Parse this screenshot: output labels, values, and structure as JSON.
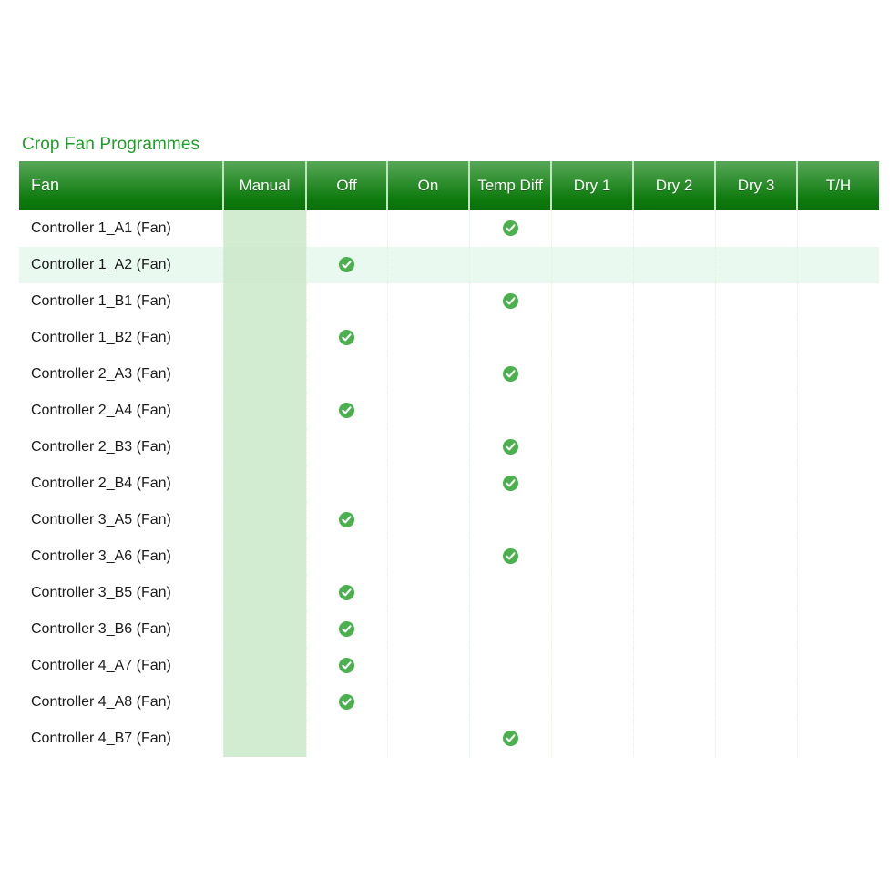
{
  "panel": {
    "title": "Crop Fan Programmes",
    "title_color": "#1e9e28",
    "header_gradient_top": "#57a757",
    "header_gradient_bottom": "#0a700a",
    "check_icon_color": "#4cb050",
    "manual_band_color": "#d2ecd2",
    "alt_row_color": "#e9f9ef"
  },
  "table": {
    "columns": [
      {
        "key": "fan",
        "label": "Fan"
      },
      {
        "key": "manual",
        "label": "Manual"
      },
      {
        "key": "off",
        "label": "Off"
      },
      {
        "key": "on",
        "label": "On"
      },
      {
        "key": "tempdiff",
        "label": "Temp Diff"
      },
      {
        "key": "dry1",
        "label": "Dry 1"
      },
      {
        "key": "dry2",
        "label": "Dry 2"
      },
      {
        "key": "dry3",
        "label": "Dry 3"
      },
      {
        "key": "th",
        "label": "T/H"
      }
    ],
    "check_glyph_name": "check-circle-icon",
    "rows": [
      {
        "fan": "Controller 1_A1 (Fan)",
        "manual": false,
        "off": false,
        "on": false,
        "tempdiff": true,
        "dry1": false,
        "dry2": false,
        "dry3": false,
        "th": false
      },
      {
        "fan": "Controller 1_A2 (Fan)",
        "manual": false,
        "off": true,
        "on": false,
        "tempdiff": false,
        "dry1": false,
        "dry2": false,
        "dry3": false,
        "th": false
      },
      {
        "fan": "Controller 1_B1 (Fan)",
        "manual": false,
        "off": false,
        "on": false,
        "tempdiff": true,
        "dry1": false,
        "dry2": false,
        "dry3": false,
        "th": false
      },
      {
        "fan": "Controller 1_B2 (Fan)",
        "manual": false,
        "off": true,
        "on": false,
        "tempdiff": false,
        "dry1": false,
        "dry2": false,
        "dry3": false,
        "th": false
      },
      {
        "fan": "Controller 2_A3 (Fan)",
        "manual": false,
        "off": false,
        "on": false,
        "tempdiff": true,
        "dry1": false,
        "dry2": false,
        "dry3": false,
        "th": false
      },
      {
        "fan": "Controller 2_A4 (Fan)",
        "manual": false,
        "off": true,
        "on": false,
        "tempdiff": false,
        "dry1": false,
        "dry2": false,
        "dry3": false,
        "th": false
      },
      {
        "fan": "Controller 2_B3 (Fan)",
        "manual": false,
        "off": false,
        "on": false,
        "tempdiff": true,
        "dry1": false,
        "dry2": false,
        "dry3": false,
        "th": false
      },
      {
        "fan": "Controller 2_B4 (Fan)",
        "manual": false,
        "off": false,
        "on": false,
        "tempdiff": true,
        "dry1": false,
        "dry2": false,
        "dry3": false,
        "th": false
      },
      {
        "fan": "Controller 3_A5 (Fan)",
        "manual": false,
        "off": true,
        "on": false,
        "tempdiff": false,
        "dry1": false,
        "dry2": false,
        "dry3": false,
        "th": false
      },
      {
        "fan": "Controller 3_A6 (Fan)",
        "manual": false,
        "off": false,
        "on": false,
        "tempdiff": true,
        "dry1": false,
        "dry2": false,
        "dry3": false,
        "th": false
      },
      {
        "fan": "Controller 3_B5 (Fan)",
        "manual": false,
        "off": true,
        "on": false,
        "tempdiff": false,
        "dry1": false,
        "dry2": false,
        "dry3": false,
        "th": false
      },
      {
        "fan": "Controller 3_B6 (Fan)",
        "manual": false,
        "off": true,
        "on": false,
        "tempdiff": false,
        "dry1": false,
        "dry2": false,
        "dry3": false,
        "th": false
      },
      {
        "fan": "Controller 4_A7 (Fan)",
        "manual": false,
        "off": true,
        "on": false,
        "tempdiff": false,
        "dry1": false,
        "dry2": false,
        "dry3": false,
        "th": false
      },
      {
        "fan": "Controller 4_A8 (Fan)",
        "manual": false,
        "off": true,
        "on": false,
        "tempdiff": false,
        "dry1": false,
        "dry2": false,
        "dry3": false,
        "th": false
      },
      {
        "fan": "Controller 4_B7 (Fan)",
        "manual": false,
        "off": false,
        "on": false,
        "tempdiff": true,
        "dry1": false,
        "dry2": false,
        "dry3": false,
        "th": false
      }
    ],
    "highlighted_row_index": 1
  }
}
